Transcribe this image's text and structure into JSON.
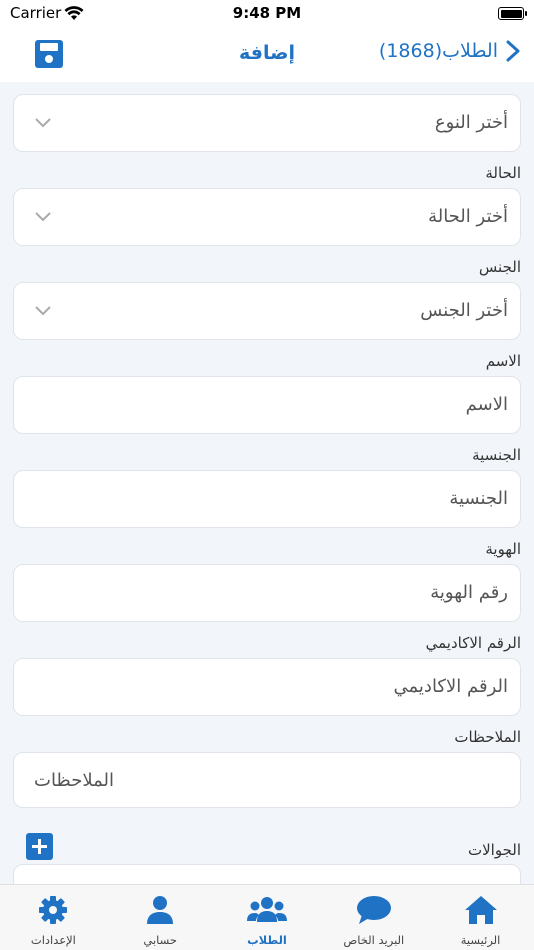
{
  "status": {
    "carrier": "Carrier",
    "time": "9:48 PM"
  },
  "nav": {
    "title": "إضافة",
    "back_label": "الطلاب(1868)"
  },
  "form": {
    "type": {
      "placeholder": "أختر النوع"
    },
    "status": {
      "label": "الحالة",
      "placeholder": "أختر الحالة"
    },
    "gender": {
      "label": "الجنس",
      "placeholder": "أختر الجنس"
    },
    "name": {
      "label": "الاسم",
      "placeholder": "الاسم"
    },
    "nationality": {
      "label": "الجنسية",
      "placeholder": "الجنسية"
    },
    "id": {
      "label": "الهوية",
      "placeholder": "رقم الهوية"
    },
    "academic": {
      "label": "الرقم الاكاديمي",
      "placeholder": "الرقم الاكاديمي"
    },
    "notes": {
      "label": "الملاحظات",
      "placeholder": "الملاحظات"
    },
    "mobiles": {
      "label": "الجوالات"
    }
  },
  "tabs": [
    {
      "label": "الإعدادات",
      "icon": "gear-icon"
    },
    {
      "label": "حسابي",
      "icon": "person-icon"
    },
    {
      "label": "الطلاب",
      "icon": "students-icon",
      "active": true
    },
    {
      "label": "البريد الخاص",
      "icon": "chat-icon"
    },
    {
      "label": "الرئيسية",
      "icon": "home-icon"
    }
  ],
  "colors": {
    "accent": "#1f72c4",
    "background": "#f2f6fb"
  }
}
